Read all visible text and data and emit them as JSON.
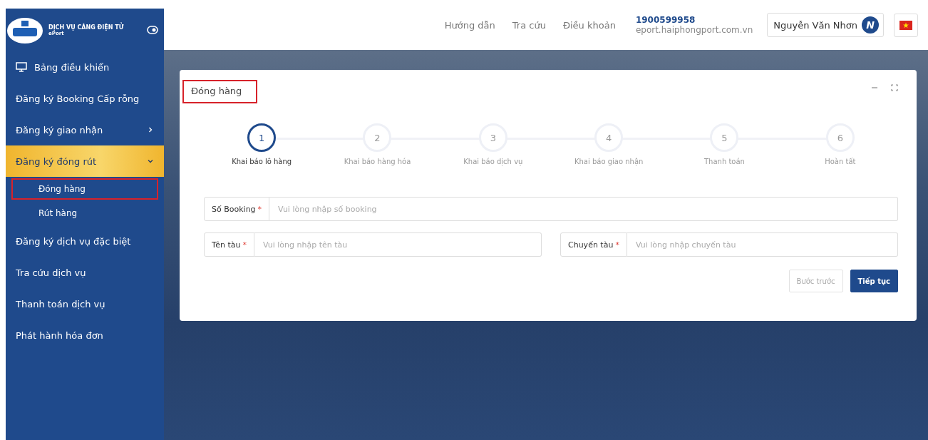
{
  "brand": {
    "title": "DỊCH VỤ CẢNG ĐIỆN TỬ",
    "subtitle": "ePort"
  },
  "sidebar": {
    "items": [
      {
        "label": "Bảng điều khiển",
        "kind": "icon",
        "selected": false
      },
      {
        "label": "Đăng ký Booking Cấp rỗng",
        "kind": "plain",
        "selected": false
      },
      {
        "label": "Đăng ký giao nhận",
        "kind": "group",
        "selected": false,
        "expanded": false
      },
      {
        "label": "Đăng ký đóng rút",
        "kind": "group",
        "selected": true,
        "expanded": true,
        "children": [
          {
            "label": "Đóng hàng",
            "highlighted": true
          },
          {
            "label": "Rút hàng",
            "highlighted": false
          }
        ]
      },
      {
        "label": "Đăng ký dịch vụ đặc biệt",
        "kind": "plain",
        "selected": false
      },
      {
        "label": "Tra cứu dịch vụ",
        "kind": "plain",
        "selected": false
      },
      {
        "label": "Thanh toán dịch vụ",
        "kind": "plain",
        "selected": false
      },
      {
        "label": "Phát hành hóa đơn",
        "kind": "plain",
        "selected": false
      }
    ]
  },
  "header": {
    "links": [
      "Hướng dẫn",
      "Tra cứu",
      "Điều khoản"
    ],
    "phone": "1900599958",
    "website": "eport.haiphongport.com.vn",
    "user": {
      "name": "Nguyễn Văn Nhơn",
      "initial": "N"
    }
  },
  "panel": {
    "title": "Đóng hàng",
    "title_highlighted": true,
    "steps": [
      {
        "number": "1",
        "label": "Khai báo lô hàng",
        "selected": true
      },
      {
        "number": "2",
        "label": "Khai báo hàng hóa",
        "selected": false
      },
      {
        "number": "3",
        "label": "Khai báo dịch vụ",
        "selected": false
      },
      {
        "number": "4",
        "label": "Khai báo giao nhận",
        "selected": false
      },
      {
        "number": "5",
        "label": "Thanh toán",
        "selected": false
      },
      {
        "number": "6",
        "label": "Hoàn tất",
        "selected": false
      }
    ],
    "fields": [
      {
        "label": "Số Booking",
        "required": "*",
        "placeholder": "Vui lòng nhập số booking",
        "kind": "full"
      },
      {
        "label": "Tên tàu",
        "required": "*",
        "placeholder": "Vui lòng nhập tên tàu",
        "kind": "half"
      },
      {
        "label": "Chuyến tàu",
        "required": "*",
        "placeholder": "Vui lòng nhập chuyến tàu",
        "kind": "half"
      }
    ],
    "buttons": [
      {
        "label": "Bước trước",
        "disabled": true
      },
      {
        "label": "Tiếp tục",
        "disabled": false
      }
    ]
  }
}
